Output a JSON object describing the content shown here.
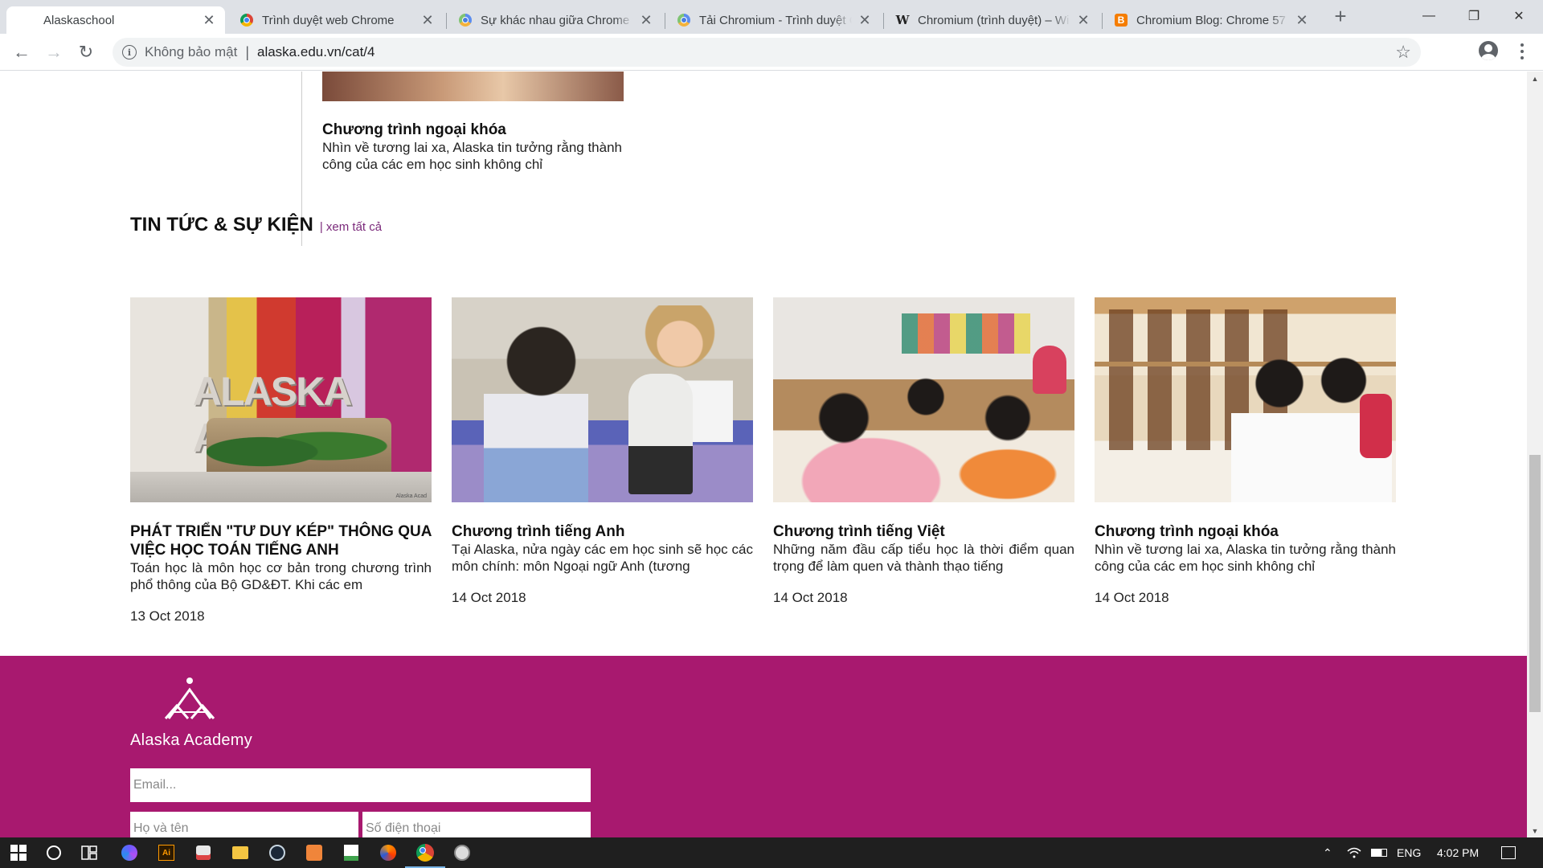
{
  "browser": {
    "tabs": [
      {
        "title": "Alaskaschool",
        "icon": "no-favicon",
        "active": true
      },
      {
        "title": "Trình duyệt web Chrome",
        "icon": "chrome-icon",
        "active": false
      },
      {
        "title": "Sự khác nhau giữa Chrome v",
        "icon": "chromium-icon",
        "active": false
      },
      {
        "title": "Tải Chromium - Trình duyệt C",
        "icon": "chromium-icon",
        "active": false
      },
      {
        "title": "Chromium (trình duyệt) – Wi",
        "icon": "wikipedia-icon",
        "active": false
      },
      {
        "title": "Chromium Blog: Chrome 57",
        "icon": "blogger-icon",
        "active": false
      }
    ],
    "tab_close_glyph": "✕",
    "new_tab_glyph": "+",
    "window_controls": {
      "minimize": "—",
      "restore": "❐",
      "close": "✕"
    },
    "address": {
      "security_label": "Không bảo mật",
      "separator": "|",
      "url": "alaska.edu.vn/cat/4",
      "info_glyph": "i",
      "star_glyph": "☆"
    },
    "nav": {
      "back": "←",
      "forward": "→",
      "reload": "↻"
    }
  },
  "page": {
    "previous_card": {
      "title": "Chương trình ngoại khóa",
      "description": "Nhìn về tương lai xa, Alaska tin tưởng rằng thành công của các em học sinh không chỉ"
    },
    "news_section": {
      "heading": "TIN TỨC & SỰ KIỆN",
      "view_all": "| xem tất cả",
      "cards": [
        {
          "title": "PHÁT TRIỂN \"TƯ DUY KÉP\" THÔNG QUA VIỆC HỌC TOÁN TIẾNG ANH",
          "description": "Toán học là môn học cơ bản trong chương trình phổ thông của Bộ GD&ĐT. Khi các em",
          "date": "13 Oct 2018",
          "photo_sign": "ALASKA ACADEMY",
          "photo_caption": "Alaska Acad"
        },
        {
          "title": "Chương trình tiếng Anh",
          "description": "Tại Alaska, nửa ngày các em học sinh sẽ học các môn chính: môn Ngoại ngữ Anh (tương",
          "date": "14 Oct 2018"
        },
        {
          "title": "Chương trình tiếng Việt",
          "description": "Những năm đầu cấp tiểu học là thời điểm quan trọng để làm quen và thành thạo tiếng",
          "date": "14 Oct 2018"
        },
        {
          "title": "Chương trình ngoại khóa",
          "description": "Nhìn về tương lai xa, Alaska tin tưởng rằng thành công của các em học sinh không chỉ",
          "date": "14 Oct 2018"
        }
      ]
    },
    "footer": {
      "brand": "Alaska Academy",
      "email_placeholder": "Email...",
      "name_placeholder": "Họ và tên",
      "phone_placeholder": "Số điện thoại",
      "background_color": "#a8196f"
    }
  },
  "taskbar": {
    "language": "ENG",
    "time": "4:02 PM",
    "apps": [
      "windows-start-icon",
      "cortana-icon",
      "task-view-icon",
      "firefox-dev-icon",
      "illustrator-icon",
      "app-icon",
      "file-explorer-icon",
      "steam-icon",
      "archive-icon",
      "spreadsheet-icon",
      "firefox-icon",
      "chrome-icon",
      "utility-icon"
    ]
  }
}
